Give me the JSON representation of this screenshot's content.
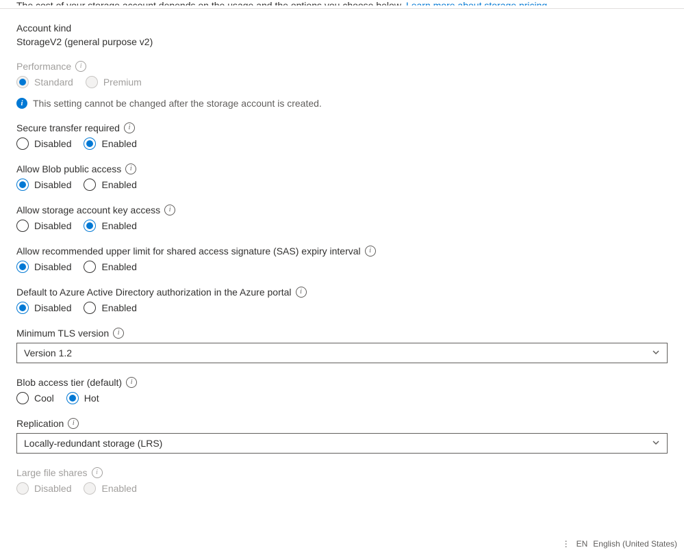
{
  "top": {
    "truncated_text": "The cost of your storage account depends on the usage and the options you choose below.",
    "link_text": "Learn more about storage pricing"
  },
  "account_kind": {
    "label": "Account kind",
    "value": "StorageV2 (general purpose v2)"
  },
  "performance": {
    "label": "Performance",
    "options": {
      "standard": "Standard",
      "premium": "Premium"
    },
    "selected": "standard",
    "disabled": true,
    "note": "This setting cannot be changed after the storage account is created."
  },
  "secure_transfer": {
    "label": "Secure transfer required",
    "options": {
      "disabled": "Disabled",
      "enabled": "Enabled"
    },
    "selected": "enabled"
  },
  "blob_public_access": {
    "label": "Allow Blob public access",
    "options": {
      "disabled": "Disabled",
      "enabled": "Enabled"
    },
    "selected": "disabled"
  },
  "account_key_access": {
    "label": "Allow storage account key access",
    "options": {
      "disabled": "Disabled",
      "enabled": "Enabled"
    },
    "selected": "enabled"
  },
  "sas_expiry": {
    "label": "Allow recommended upper limit for shared access signature (SAS) expiry interval",
    "options": {
      "disabled": "Disabled",
      "enabled": "Enabled"
    },
    "selected": "disabled"
  },
  "aad_auth": {
    "label": "Default to Azure Active Directory authorization in the Azure portal",
    "options": {
      "disabled": "Disabled",
      "enabled": "Enabled"
    },
    "selected": "disabled"
  },
  "tls": {
    "label": "Minimum TLS version",
    "value": "Version 1.2"
  },
  "blob_tier": {
    "label": "Blob access tier (default)",
    "options": {
      "cool": "Cool",
      "hot": "Hot"
    },
    "selected": "hot"
  },
  "replication": {
    "label": "Replication",
    "value": "Locally-redundant storage (LRS)"
  },
  "large_file_shares": {
    "label": "Large file shares",
    "options": {
      "disabled": "Disabled",
      "enabled": "Enabled"
    },
    "disabled": true
  },
  "status": {
    "lang_code": "EN",
    "lang_name": "English (United States)"
  },
  "icons": {
    "info_glyph": "i"
  }
}
